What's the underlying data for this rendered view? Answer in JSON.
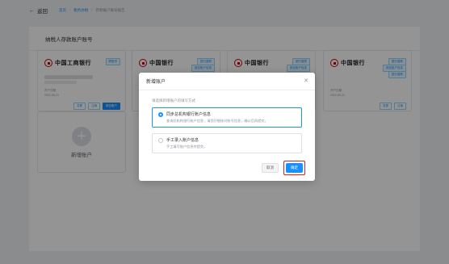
{
  "header": {
    "back_label": "返回",
    "breadcrumbs": [
      "首页",
      "税务办税",
      "存款账户账号报告"
    ]
  },
  "panel": {
    "title": "纳税人存款账户账号"
  },
  "cards": [
    {
      "bank_name": "中国工商银行",
      "tags": [
        "跨账号"
      ],
      "meta": [
        "开户日期",
        "2022-06-21"
      ],
      "buttons": [
        "变更",
        "注销",
        "报告账户"
      ]
    },
    {
      "bank_name": "中国银行",
      "tags": [
        "银行直联",
        "报告账户信息"
      ],
      "meta": [],
      "buttons": []
    },
    {
      "bank_name": "中国银行",
      "tags": [
        "银行直联",
        "报告账户信息"
      ],
      "meta": [],
      "buttons": []
    },
    {
      "bank_name": "中国银行",
      "tags": [
        "银行直联",
        "报告账户信息",
        "银行直联"
      ],
      "meta": [
        "开户日期",
        "2022-05-21"
      ],
      "buttons": [
        "变更",
        "注销"
      ]
    }
  ],
  "add_card": {
    "label": "新增账户"
  },
  "modal": {
    "title": "新增账户",
    "hint": "请选择新增账户的填写方式",
    "options": [
      {
        "title": "同步总机构银行账户信息",
        "desc": "查询总机构银行账户信息，请您仔细核对账号信息，确认后再提交。",
        "selected": true
      },
      {
        "title": "手工录入账户信息",
        "desc": "手工填写账户信息并提交。",
        "selected": false
      }
    ],
    "cancel_label": "取消",
    "ok_label": "确定"
  },
  "colors": {
    "primary": "#1890ff",
    "highlight_border": "#e02020",
    "bank_red": "#c7000b"
  }
}
